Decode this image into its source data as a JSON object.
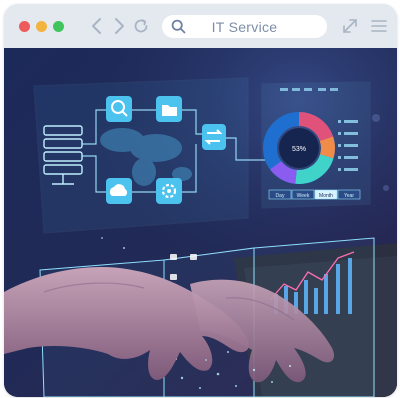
{
  "browser": {
    "search_text": "IT Service"
  },
  "icons": {
    "close": "red-dot",
    "minimize": "yellow-dot",
    "maximize": "green-dot",
    "back": "chevron-left-icon",
    "forward": "chevron-right-icon",
    "reload": "reload-icon",
    "search": "search-icon",
    "expand": "expand-icon",
    "menu": "hamburger-menu-icon"
  },
  "hologram": {
    "donut_center": "53%",
    "tabs": [
      "Day",
      "Week",
      "Month",
      "Year"
    ]
  },
  "colors": {
    "toolbar": "#e4e9ef",
    "accent": "#4fb6ea",
    "hologram": "#8fe0ff"
  }
}
